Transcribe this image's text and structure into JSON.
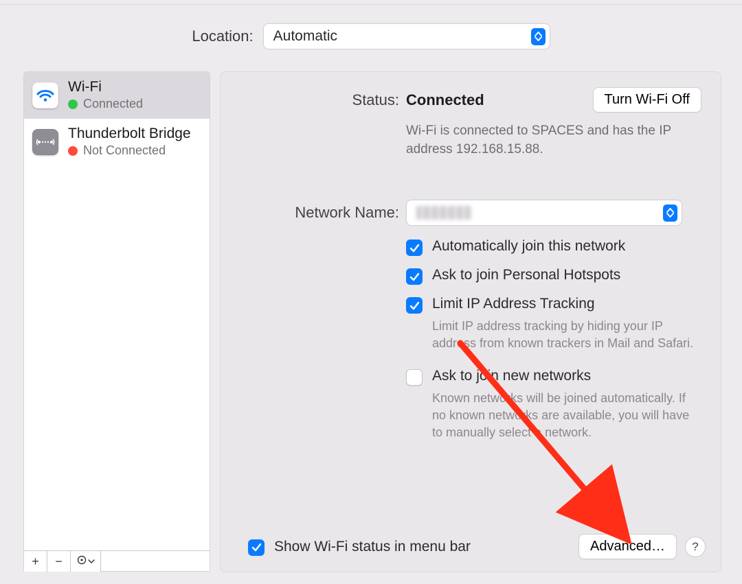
{
  "location": {
    "label": "Location:",
    "value": "Automatic"
  },
  "sidebar": {
    "items": [
      {
        "title": "Wi-Fi",
        "status": "Connected"
      },
      {
        "title": "Thunderbolt Bridge",
        "status": "Not Connected"
      }
    ]
  },
  "status": {
    "label": "Status:",
    "value": "Connected",
    "toggle": "Turn Wi-Fi Off",
    "desc": "Wi-Fi is connected to SPACES and has the IP address 192.168.15.88."
  },
  "network": {
    "label": "Network Name:",
    "checks": {
      "auto_join": "Automatically join this network",
      "ask_hotspot": "Ask to join Personal Hotspots",
      "limit_ip": "Limit IP Address Tracking",
      "limit_ip_sub": "Limit IP address tracking by hiding your IP address from known trackers in Mail and Safari.",
      "ask_new": "Ask to join new networks",
      "ask_new_sub": "Known networks will be joined automatically. If no known networks are available, you will have to manually select a network."
    }
  },
  "bottom": {
    "show_status": "Show Wi-Fi status in menu bar",
    "advanced": "Advanced…",
    "help": "?"
  },
  "toolbar": {
    "plus": "+",
    "minus": "−",
    "gear": "⊙",
    "chev": "⌄"
  }
}
